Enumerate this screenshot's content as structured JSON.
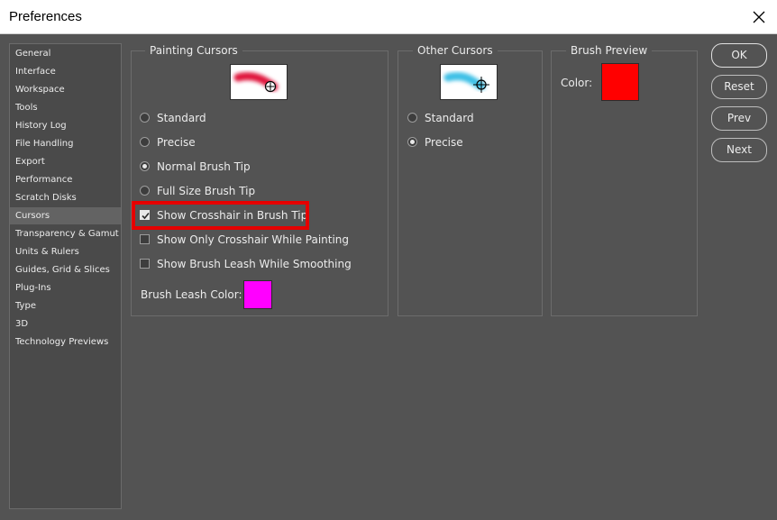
{
  "window": {
    "title": "Preferences",
    "close_icon": "close-icon"
  },
  "sidebar": {
    "items": [
      {
        "label": "General"
      },
      {
        "label": "Interface"
      },
      {
        "label": "Workspace"
      },
      {
        "label": "Tools"
      },
      {
        "label": "History Log"
      },
      {
        "label": "File Handling"
      },
      {
        "label": "Export"
      },
      {
        "label": "Performance"
      },
      {
        "label": "Scratch Disks"
      },
      {
        "label": "Cursors",
        "selected": true
      },
      {
        "label": "Transparency & Gamut"
      },
      {
        "label": "Units & Rulers"
      },
      {
        "label": "Guides, Grid & Slices"
      },
      {
        "label": "Plug-Ins"
      },
      {
        "label": "Type"
      },
      {
        "label": "3D"
      },
      {
        "label": "Technology Previews"
      }
    ]
  },
  "painting_cursors": {
    "title": "Painting Cursors",
    "preview_color": "#e0173c",
    "options": [
      {
        "label": "Standard",
        "type": "radio",
        "checked": false
      },
      {
        "label": "Precise",
        "type": "radio",
        "checked": false
      },
      {
        "label": "Normal Brush Tip",
        "type": "radio",
        "checked": true
      },
      {
        "label": "Full Size Brush Tip",
        "type": "radio",
        "checked": false
      },
      {
        "label": "Show Crosshair in Brush Tip",
        "type": "checkbox",
        "checked": true,
        "highlighted": true
      },
      {
        "label": "Show Only Crosshair While Painting",
        "type": "checkbox",
        "checked": false
      },
      {
        "label": "Show Brush Leash While Smoothing",
        "type": "checkbox",
        "checked": false
      }
    ],
    "leash_color_label": "Brush Leash Color:",
    "leash_color": "#ff00ff"
  },
  "other_cursors": {
    "title": "Other Cursors",
    "preview_color": "#3cc0e6",
    "options": [
      {
        "label": "Standard",
        "type": "radio",
        "checked": false
      },
      {
        "label": "Precise",
        "type": "radio",
        "checked": true
      }
    ]
  },
  "brush_preview": {
    "title": "Brush Preview",
    "color_label": "Color:",
    "color": "#ff0000"
  },
  "buttons": {
    "ok": "OK",
    "reset": "Reset",
    "prev": "Prev",
    "next": "Next"
  },
  "colors": {
    "highlight": "#e60000",
    "dialog_bg": "#535353"
  }
}
